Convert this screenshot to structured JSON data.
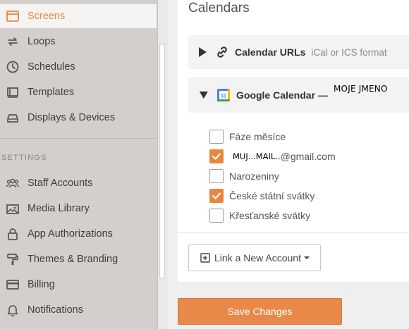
{
  "sidebar": {
    "items": [
      {
        "label": "Screens",
        "icon": "screens-icon",
        "active": true
      },
      {
        "label": "Loops",
        "icon": "loops-icon"
      },
      {
        "label": "Schedules",
        "icon": "clock-icon"
      },
      {
        "label": "Templates",
        "icon": "templates-icon"
      },
      {
        "label": "Displays & Devices",
        "icon": "display-device-icon"
      }
    ],
    "settings_heading": "SETTINGS",
    "settings_items": [
      {
        "label": "Staff Accounts",
        "icon": "staff-icon"
      },
      {
        "label": "Media Library",
        "icon": "media-icon"
      },
      {
        "label": "App Authorizations",
        "icon": "lock-icon"
      },
      {
        "label": "Themes & Branding",
        "icon": "paint-roller-icon"
      },
      {
        "label": "Billing",
        "icon": "credit-card-icon"
      },
      {
        "label": "Notifications",
        "icon": "bell-icon"
      }
    ]
  },
  "main": {
    "title": "Calendars",
    "calendar_urls": {
      "name": "Calendar URLs",
      "description": "iCal or ICS format"
    },
    "google_calendar": {
      "name": "Google Calendar —",
      "owner": "MOJE JMENO"
    },
    "calendars": [
      {
        "label": "Fáze měsíce",
        "checked": false
      },
      {
        "label_a": "MUJ...MAIL..",
        "label_b": "@gmail.com",
        "checked": true
      },
      {
        "label": "Narozeniny",
        "checked": false
      },
      {
        "label": "České státní svátky",
        "checked": true
      },
      {
        "label": "Křesťanské svátky",
        "checked": false
      }
    ],
    "link_account_label": "Link a New Account",
    "save_label": "Save Changes"
  },
  "colors": {
    "accent": "#e8863e",
    "sidebar_bg": "#d2cfcc"
  }
}
